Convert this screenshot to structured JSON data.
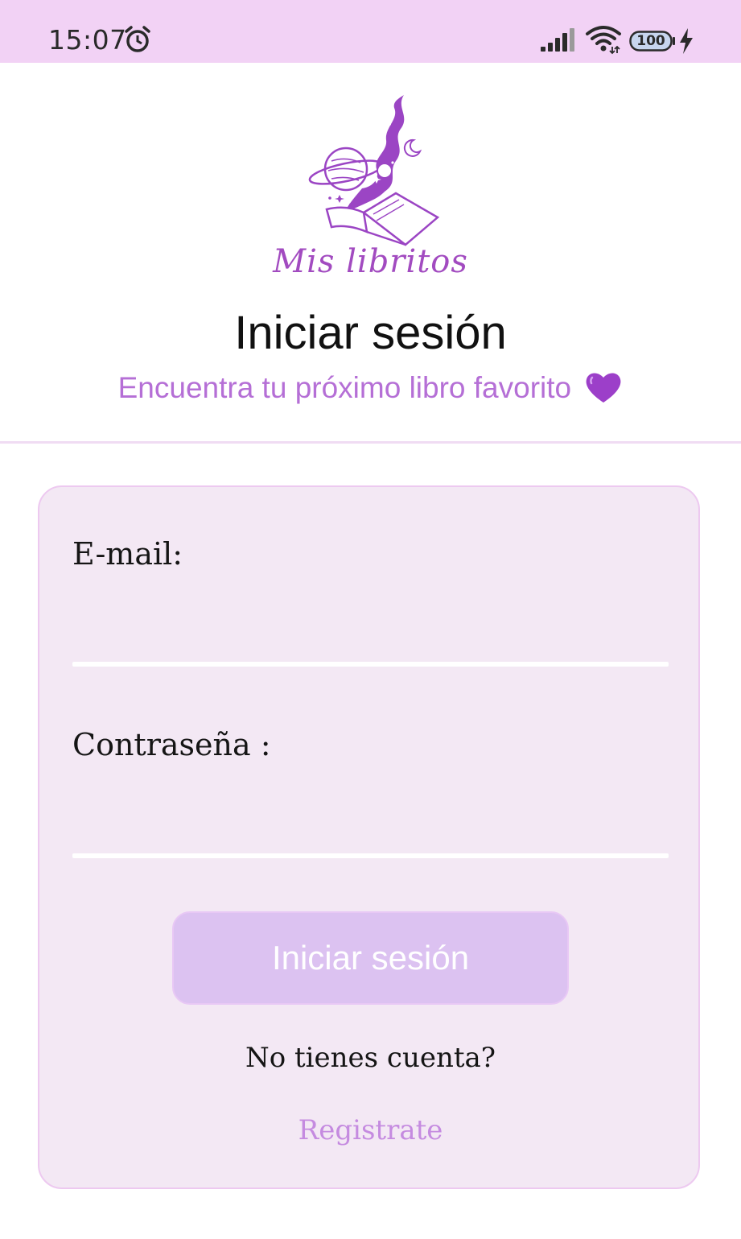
{
  "status_bar": {
    "time": "15:07",
    "battery_level": "100",
    "icons": [
      "alarm-icon",
      "signal-icon",
      "wifi-icon",
      "battery-icon",
      "charging-icon"
    ]
  },
  "header": {
    "logo_text": "Mis libritos",
    "title": "Iniciar sesión",
    "subtitle": "Encuentra tu próximo libro favorito",
    "subtitle_icon": "purple-heart-icon"
  },
  "form": {
    "email_label": "E-mail:",
    "email_value": "",
    "password_label": "Contraseña :",
    "password_value": "",
    "submit_label": "Iniciar sesión",
    "no_account_text": "No tienes cuenta?",
    "register_label": "Registrate"
  },
  "colors": {
    "status_bar_bg": "#f2d2f5",
    "card_bg": "#f3e8f4",
    "accent": "#b56fd6",
    "logo": "#a24bc0",
    "button_bg": "#dcc2f1",
    "link": "#c58be0"
  }
}
